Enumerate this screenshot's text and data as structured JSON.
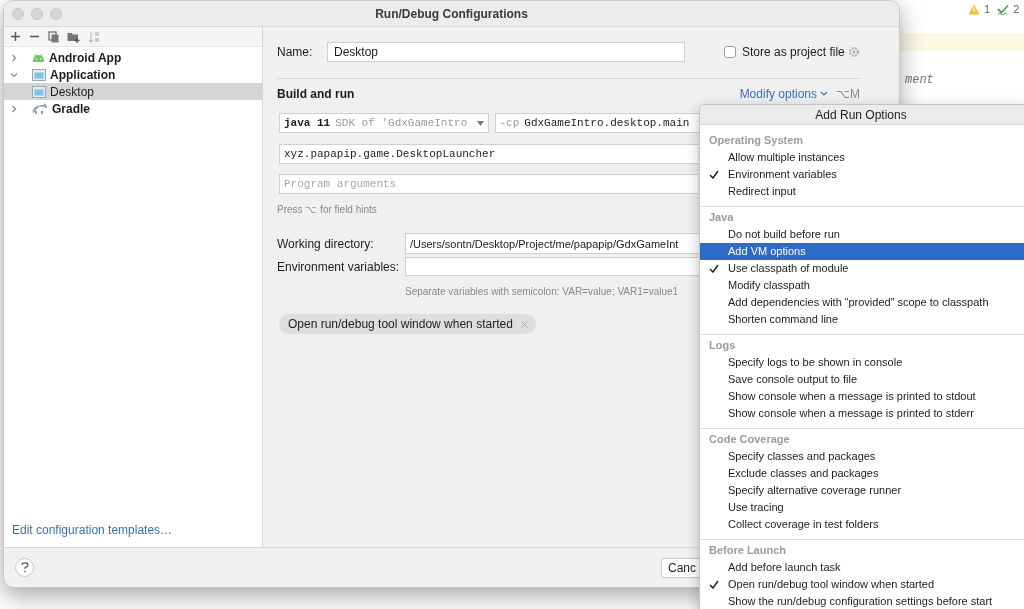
{
  "window": {
    "title": "Run/Debug Configurations"
  },
  "editor": {
    "inspections": [
      {
        "kind": "warning",
        "count": "1"
      },
      {
        "kind": "typo",
        "count": "2"
      }
    ],
    "code_fragment": "ment"
  },
  "tree": {
    "items": [
      {
        "label": "Android App",
        "kind": "android",
        "expanded": false,
        "selected": false
      },
      {
        "label": "Application",
        "kind": "window",
        "expanded": true,
        "selected": false,
        "children": [
          {
            "label": "Desktop",
            "kind": "window",
            "selected": true
          }
        ]
      },
      {
        "label": "Gradle",
        "kind": "gradle",
        "expanded": false,
        "selected": false
      }
    ]
  },
  "templates_link": "Edit configuration templates…",
  "form": {
    "name_label": "Name:",
    "name_value": "Desktop",
    "store_label": "Store as project file",
    "store_checked": false,
    "section_title": "Build and run",
    "modify_options": "Modify options",
    "modify_shortcut": "⌥M",
    "jre_version": "java 11",
    "jre_detail": "SDK of 'GdxGameIntro",
    "classpath_flag": "-cp",
    "classpath_module": "GdxGameIntro.desktop.main",
    "main_class": "xyz.papapip.game.DesktopLauncher",
    "args_placeholder": "Program arguments",
    "hint": "Press ⌥ for field hints",
    "workdir_label": "Working directory:",
    "workdir_value": "/Users/sontn/Desktop/Project/me/papapip/GdxGameInt",
    "env_label": "Environment variables:",
    "env_hint": "Separate variables with semicolon: VAR=value; VAR1=value1",
    "chips": [
      {
        "label": "Open run/debug tool window when started"
      }
    ]
  },
  "buttons": [
    {
      "label": "Canc"
    }
  ],
  "popup": {
    "title": "Add Run Options",
    "sections": [
      {
        "title": "Operating System",
        "items": [
          {
            "label": "Allow multiple instances",
            "checked": false,
            "selected": false
          },
          {
            "label": "Environment variables",
            "checked": true,
            "selected": false
          },
          {
            "label": "Redirect input",
            "checked": false,
            "selected": false
          }
        ]
      },
      {
        "title": "Java",
        "items": [
          {
            "label": "Do not build before run",
            "checked": false,
            "selected": false
          },
          {
            "label": "Add VM options",
            "checked": false,
            "selected": true
          },
          {
            "label": "Use classpath of module",
            "checked": true,
            "selected": false
          },
          {
            "label": "Modify classpath",
            "checked": false,
            "selected": false
          },
          {
            "label": "Add dependencies with “provided” scope to classpath",
            "checked": false,
            "selected": false
          },
          {
            "label": "Shorten command line",
            "checked": false,
            "selected": false
          }
        ]
      },
      {
        "title": "Logs",
        "items": [
          {
            "label": "Specify logs to be shown in console",
            "checked": false,
            "selected": false
          },
          {
            "label": "Save console output to file",
            "checked": false,
            "selected": false
          },
          {
            "label": "Show console when a message is printed to stdout",
            "checked": false,
            "selected": false
          },
          {
            "label": "Show console when a message is printed to stderr",
            "checked": false,
            "selected": false
          }
        ]
      },
      {
        "title": "Code Coverage",
        "items": [
          {
            "label": "Specify classes and packages",
            "checked": false,
            "selected": false
          },
          {
            "label": "Exclude classes and packages",
            "checked": false,
            "selected": false
          },
          {
            "label": "Specify alternative coverage runner",
            "checked": false,
            "selected": false
          },
          {
            "label": "Use tracing",
            "checked": false,
            "selected": false
          },
          {
            "label": "Collect coverage in test folders",
            "checked": false,
            "selected": false
          }
        ]
      },
      {
        "title": "Before Launch",
        "items": [
          {
            "label": "Add before launch task",
            "checked": false,
            "selected": false
          },
          {
            "label": "Open run/debug tool window when started",
            "checked": true,
            "selected": false
          },
          {
            "label": "Show the run/debug configuration settings before start",
            "checked": false,
            "selected": false
          }
        ]
      }
    ]
  }
}
